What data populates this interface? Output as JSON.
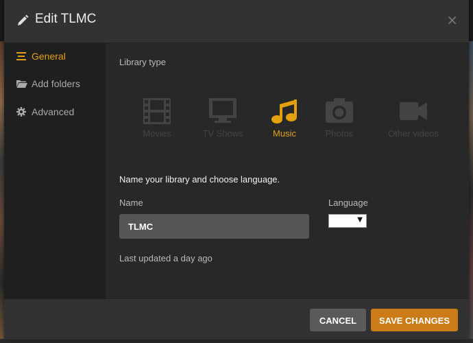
{
  "dialog": {
    "title": "Edit TLMC",
    "close_symbol": "×"
  },
  "sidebar": {
    "items": [
      {
        "label": "General",
        "icon": "list-icon",
        "active": true
      },
      {
        "label": "Add folders",
        "icon": "folder-icon",
        "active": false
      },
      {
        "label": "Advanced",
        "icon": "gear-icon",
        "active": false
      }
    ]
  },
  "library": {
    "section_label": "Library type",
    "types": [
      {
        "label": "Movies",
        "icon": "film-icon",
        "selected": false
      },
      {
        "label": "TV Shows",
        "icon": "tv-icon",
        "selected": false
      },
      {
        "label": "Music",
        "icon": "music-note-icon",
        "selected": true
      },
      {
        "label": "Photos",
        "icon": "camera-icon",
        "selected": false
      },
      {
        "label": "Other videos",
        "icon": "video-camera-icon",
        "selected": false
      }
    ]
  },
  "form": {
    "prompt": "Name your library and choose language.",
    "name_label": "Name",
    "name_value": "TLMC",
    "language_label": "Language",
    "language_value": "",
    "last_updated": "Last updated a day ago"
  },
  "footer": {
    "cancel_label": "CANCEL",
    "save_label": "SAVE CHANGES"
  },
  "colors": {
    "accent": "#e5a00d",
    "save_button": "#cc7b19",
    "cancel_button": "#5a5a5a"
  }
}
